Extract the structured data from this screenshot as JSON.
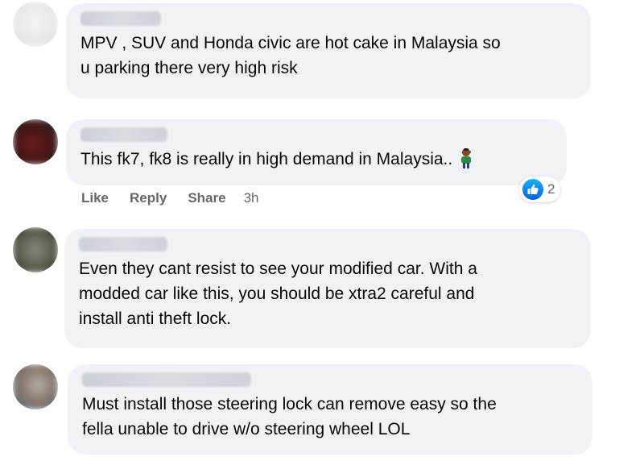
{
  "comments": [
    {
      "text": "MPV , SUV and Honda civic are hot cake in Malaysia so\nu parking there very high risk"
    },
    {
      "text": "This fk7, fk8 is really in high demand in Malaysia..",
      "emoji": "face-palm-person-emoji",
      "actions": {
        "like": "Like",
        "reply": "Reply",
        "share": "Share",
        "time": "3h"
      },
      "reaction_count": "2"
    },
    {
      "text": "Even they cant resist to see your modified car. With a\nmodded car like this, you should be xtra2 careful and\ninstall anti theft lock."
    },
    {
      "text": "Must install those steering lock can remove easy so the\nfella unable to drive w/o steering wheel LOL"
    }
  ],
  "colors": {
    "bubble": "#f0f2f5",
    "text": "#050505",
    "secondary": "#65676b",
    "like_blue": "#0062df"
  }
}
